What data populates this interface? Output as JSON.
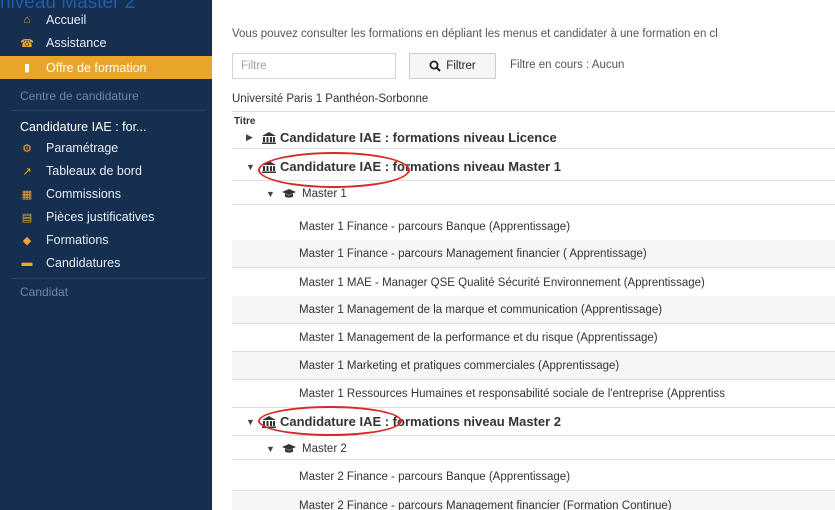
{
  "overlay": {
    "title": "niveau Master 2"
  },
  "sidebar": {
    "nav": [
      {
        "label": "Accueil",
        "icon": "home-icon",
        "glyph": "⌂"
      },
      {
        "label": "Assistance",
        "icon": "assistance-icon",
        "glyph": "☎"
      },
      {
        "label": "Offre de formation",
        "icon": "bookmark-icon",
        "glyph": "▮",
        "active": true
      }
    ],
    "section_centre": "Centre de candidature",
    "app_name": "Candidature IAE : for...",
    "app_items": [
      {
        "label": "Paramétrage",
        "icon": "settings-icon",
        "glyph": "⚙"
      },
      {
        "label": "Tableaux de bord",
        "icon": "chart-icon",
        "glyph": "↗"
      },
      {
        "label": "Commissions",
        "icon": "calendar-icon",
        "glyph": "▦"
      },
      {
        "label": "Pièces justificatives",
        "icon": "document-icon",
        "glyph": "▤"
      },
      {
        "label": "Formations",
        "icon": "tag-icon",
        "glyph": "◆"
      },
      {
        "label": "Candidatures",
        "icon": "briefcase-icon",
        "glyph": "▬"
      }
    ],
    "section_candidat": "Candidat"
  },
  "main": {
    "intro": "Vous pouvez consulter les formations en dépliant les menus et candidater à une formation en cl",
    "filter": {
      "placeholder": "Filtre",
      "button_label": "Filtrer",
      "status": "Filtre en cours : Aucun"
    },
    "university": "Université Paris 1 Panthéon-Sorbonne",
    "table_header": "Titre",
    "groups": {
      "licence": "Candidature IAE : formations niveau Licence",
      "master1": "Candidature IAE : formations niveau Master 1",
      "master2": "Candidature IAE : formations niveau Master 2"
    },
    "subgroups": {
      "master1": "Master 1",
      "master2": "Master 2"
    },
    "master1_items": [
      "Master 1 Finance - parcours Banque (Apprentissage)",
      "Master 1 Finance - parcours Management financier ( Apprentissage)",
      "Master 1 MAE - Manager QSE Qualité Sécurité Environnement (Apprentissage)",
      "Master 1 Management de la marque et communication (Apprentissage)",
      "Master 1 Management de la performance et du risque (Apprentissage)",
      "Master 1 Marketing et pratiques commerciales (Apprentissage)",
      "Master 1 Ressources Humaines et responsabilité sociale de l'entreprise (Apprentiss"
    ],
    "master2_items": [
      "Master 2 Finance - parcours Banque (Apprentissage)",
      "Master 2 Finance - parcours Management financier (Formation Continue)"
    ]
  },
  "colors": {
    "sidebar_bg": "#162e50",
    "active_bg": "#e9a52a",
    "annotation": "#d42a2a"
  }
}
